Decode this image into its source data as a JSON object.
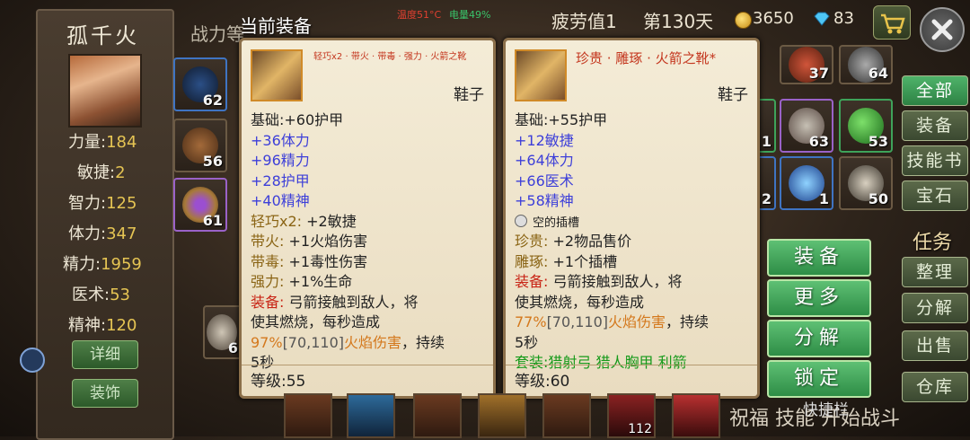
{
  "status": {
    "temperature": "温度51°C",
    "battery": "电量49%"
  },
  "header": {
    "fatigue": "疲劳值1",
    "day": "第130天",
    "gold": "3650",
    "gems": "83"
  },
  "character": {
    "name": "孤千火",
    "power_label": "战力等",
    "stats": [
      {
        "label": "力量:",
        "value": "184"
      },
      {
        "label": "敏捷:",
        "value": "2"
      },
      {
        "label": "智力:",
        "value": "125"
      },
      {
        "label": "体力:",
        "value": "347"
      },
      {
        "label": "精力:",
        "value": "1959"
      },
      {
        "label": "医术:",
        "value": "53"
      },
      {
        "label": "精神:",
        "value": "120"
      }
    ],
    "detail_button": "详细",
    "decoration_button": "装饰",
    "companion_level": "6"
  },
  "inventory_left": [
    "62",
    "56",
    "61"
  ],
  "inventory_right": [
    "37",
    "64",
    "63",
    "53",
    "1",
    "2",
    "1",
    "50"
  ],
  "current_equip": {
    "header": "当前装备",
    "topline": "轻巧x2 · 带火 · 带毒 · 强力 · 火箭之靴",
    "type": "鞋子",
    "lines": [
      {
        "text": "基础:+60护甲",
        "cls": "blk"
      },
      {
        "text": "+36体力",
        "cls": "blu"
      },
      {
        "text": "+96精力",
        "cls": "blu"
      },
      {
        "text": "+28护甲",
        "cls": "blu"
      },
      {
        "text": "+40精神",
        "cls": "blu"
      },
      {
        "text": "轻巧x2:",
        "text2": " +2敏捷",
        "cls": "brn",
        "cls2": "blk"
      },
      {
        "text": "带火:",
        "text2": " +1火焰伤害",
        "cls": "brn",
        "cls2": "blk"
      },
      {
        "text": "带毒:",
        "text2": " +1毒性伤害",
        "cls": "brn",
        "cls2": "blk"
      },
      {
        "text": "强力:",
        "text2": " +1%生命",
        "cls": "brn",
        "cls2": "blk"
      },
      {
        "text": "装备:",
        "text2": " 弓箭接触到敌人，将",
        "cls": "red",
        "cls2": "blk"
      },
      {
        "text": "使其燃烧，每秒造成",
        "cls": "blk"
      },
      {
        "text": "97%",
        "text2": "[70,110]",
        "text3": "火焰伤害",
        "text4": "，持续",
        "cls": "org",
        "cls2": "gry",
        "cls3": "org",
        "cls4": "blk"
      },
      {
        "text": "5秒",
        "cls": "blk"
      }
    ],
    "level": "等级:55"
  },
  "compare_equip": {
    "topline": "珍贵 · 雕琢 · 火箭之靴*",
    "type": "鞋子",
    "lines": [
      {
        "text": "基础:+55护甲",
        "cls": "blk"
      },
      {
        "text": "+12敏捷",
        "cls": "blu"
      },
      {
        "text": "+64体力",
        "cls": "blu"
      },
      {
        "text": "+66医术",
        "cls": "blu"
      },
      {
        "text": "+58精神",
        "cls": "blu"
      },
      {
        "text": "空的插槽",
        "cls": "blk",
        "socket": true
      },
      {
        "text": "珍贵:",
        "text2": " +2物品售价",
        "cls": "brn",
        "cls2": "blk"
      },
      {
        "text": "雕琢:",
        "text2": " +1个插槽",
        "cls": "brn",
        "cls2": "blk"
      },
      {
        "text": "装备:",
        "text2": " 弓箭接触到敌人，将",
        "cls": "red",
        "cls2": "blk"
      },
      {
        "text": "使其燃烧，每秒造成",
        "cls": "blk"
      },
      {
        "text": "77%",
        "text2": "[70,110]",
        "text3": "火焰伤害",
        "text4": "，持续",
        "cls": "org",
        "cls2": "gry",
        "cls3": "org",
        "cls4": "blk"
      },
      {
        "text": "5秒",
        "cls": "blk"
      },
      {
        "text": "套装:猎射弓 猎人胸甲 利箭",
        "cls": "grn"
      }
    ],
    "level": "等级:60"
  },
  "actions": [
    "装备",
    "更多",
    "分解",
    "锁定"
  ],
  "tabs": [
    "全部",
    "装备",
    "技能书",
    "宝石"
  ],
  "task_label": "任务",
  "side_buttons": [
    "整理",
    "分解",
    "出售",
    "仓库"
  ],
  "quickbar_label": "快捷栏",
  "bottom_text": "祝福 技能   开始战斗",
  "skills": [
    "",
    "",
    "",
    "",
    "",
    "",
    "112",
    ""
  ]
}
